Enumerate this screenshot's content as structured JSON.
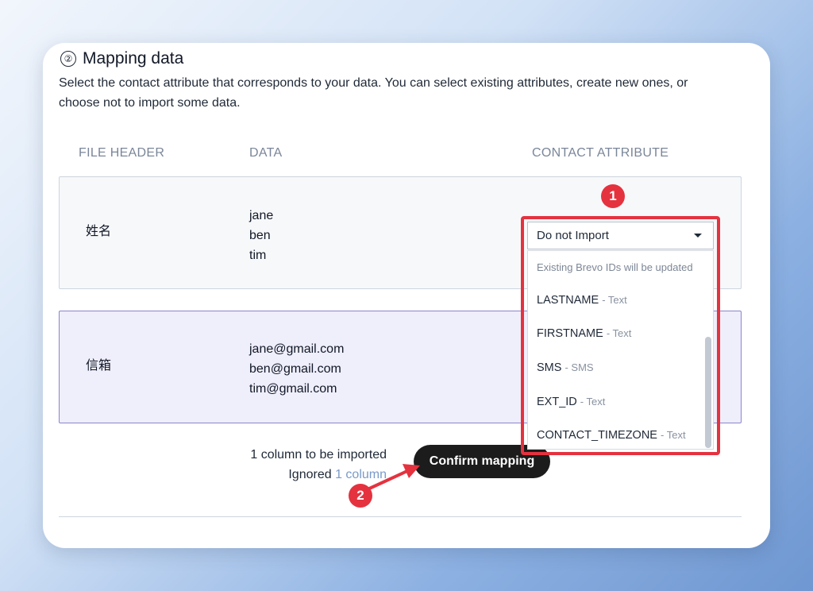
{
  "section": {
    "step": "②",
    "title": "Mapping data",
    "description": "Select the contact attribute that corresponds to your data. You can select existing attributes, create new ones, or choose not to import some data."
  },
  "table": {
    "headers": {
      "file_header": "FILE HEADER",
      "data": "DATA",
      "contact_attribute": "CONTACT ATTRIBUTE"
    },
    "rows": [
      {
        "header": "姓名",
        "values": [
          "jane",
          "ben",
          "tim"
        ]
      },
      {
        "header": "信箱",
        "values": [
          "jane@gmail.com",
          "ben@gmail.com",
          "tim@gmail.com"
        ]
      }
    ]
  },
  "dropdown": {
    "selected": "Do not Import",
    "note": "Existing Brevo IDs will be updated",
    "options": [
      {
        "name": "LASTNAME",
        "type": "- Text"
      },
      {
        "name": "FIRSTNAME",
        "type": "- Text"
      },
      {
        "name": "SMS",
        "type": "- SMS"
      },
      {
        "name": "EXT_ID",
        "type": "- Text"
      },
      {
        "name": "CONTACT_TIMEZONE",
        "type": "- Text"
      }
    ]
  },
  "footer": {
    "imported_text": "1 column to be imported",
    "ignored_prefix": "Ignored",
    "ignored_link": "1 column",
    "confirm_label": "Confirm mapping"
  },
  "annotations": {
    "badge1": "1",
    "badge2": "2",
    "color": "#e5323f"
  }
}
